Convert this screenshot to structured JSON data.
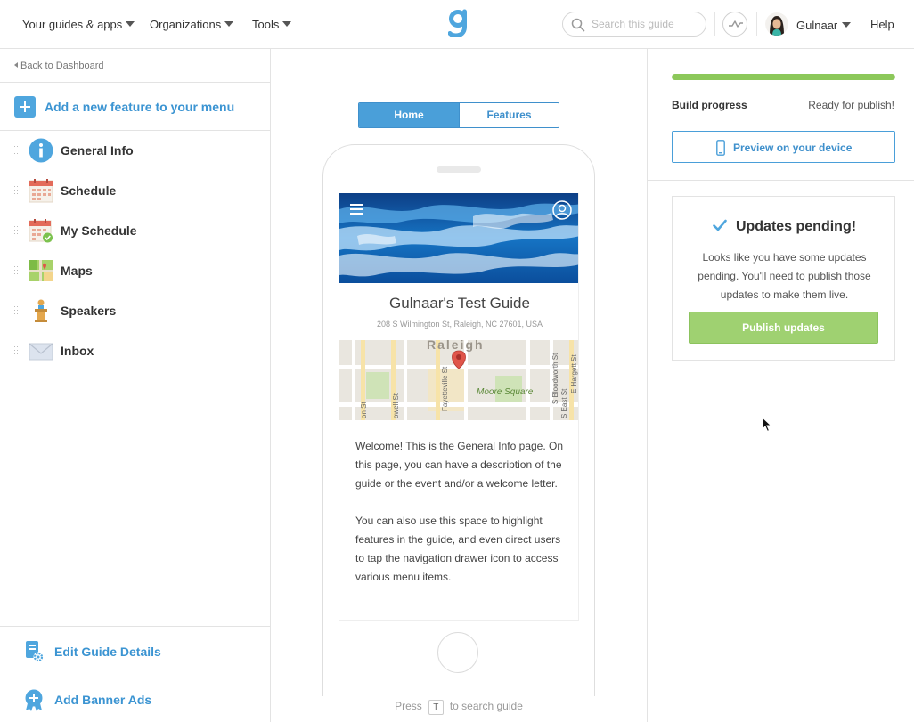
{
  "topbar": {
    "nav": [
      {
        "label": "Your guides & apps"
      },
      {
        "label": "Organizations"
      },
      {
        "label": "Tools"
      }
    ],
    "search_placeholder": "Search this guide",
    "user_name": "Gulnaar",
    "help_label": "Help",
    "brand_color": "#4fa6de"
  },
  "sidebar": {
    "back_label": "Back to Dashboard",
    "add_feature_label": "Add a new feature to your menu",
    "items": [
      {
        "label": "General Info",
        "icon": "info-icon"
      },
      {
        "label": "Schedule",
        "icon": "calendar-icon"
      },
      {
        "label": "My Schedule",
        "icon": "calendar-check-icon"
      },
      {
        "label": "Maps",
        "icon": "map-icon"
      },
      {
        "label": "Speakers",
        "icon": "podium-icon"
      },
      {
        "label": "Inbox",
        "icon": "envelope-icon"
      }
    ],
    "bottom": {
      "edit_details_label": "Edit Guide Details",
      "banner_ads_label": "Add Banner Ads"
    }
  },
  "preview": {
    "tabs": [
      {
        "label": "Home",
        "active": true
      },
      {
        "label": "Features",
        "active": false
      }
    ],
    "guide_title": "Gulnaar's Test Guide",
    "guide_address": "208 S Wilmington St, Raleigh, NC 27601, USA",
    "map_labels": {
      "city": "Raleigh",
      "street_1": "Fayetteville St",
      "street_2": "owell St",
      "street_3": "S Bloodworth St",
      "street_4": "E Hargett St",
      "park": "Moore Square",
      "street_5": "on St",
      "street_6": "S East St"
    },
    "welcome_paragraphs": [
      "Welcome! This is the General Info page. On this page, you can have a description of the guide or the event and/or a welcome letter.",
      "You can also use this space to highlight features in the guide, and even direct users to tap the navigation drawer icon to access various menu items."
    ],
    "hint_prefix": "Press",
    "hint_key": "T",
    "hint_suffix": "to search guide"
  },
  "right": {
    "build_progress_label": "Build progress",
    "build_status": "Ready for publish!",
    "progress_fraction": 1.0,
    "progress_color": "#8cc85a",
    "preview_label": "Preview on your device",
    "pending_title": "Updates pending!",
    "pending_text": "Looks like you have some updates pending. You'll need to publish those updates to make them live.",
    "publish_label": "Publish updates"
  }
}
